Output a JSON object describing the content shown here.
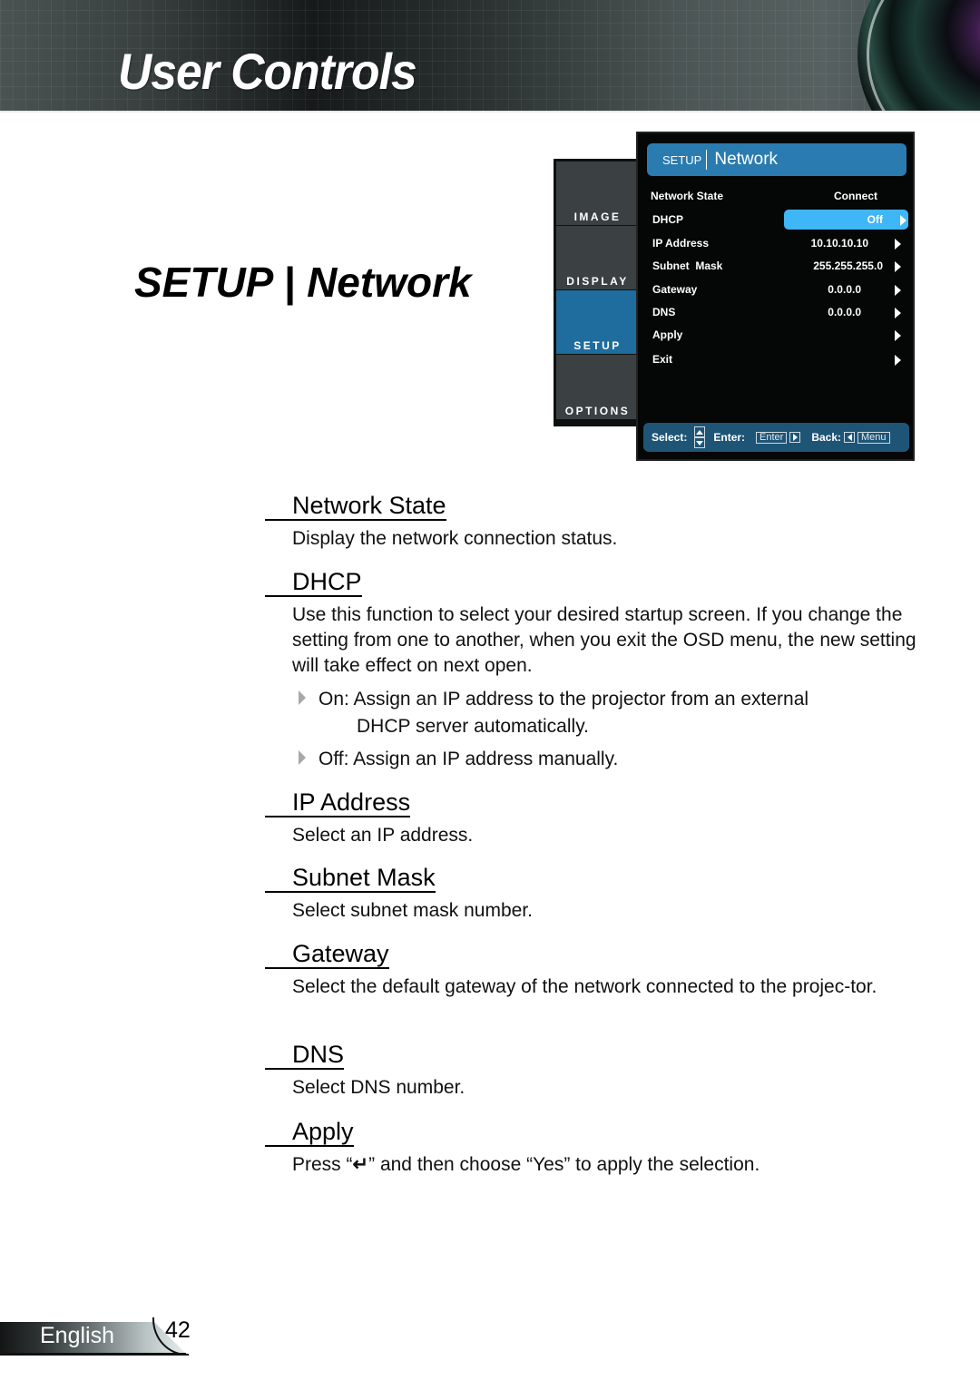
{
  "header": {
    "title": "User Controls"
  },
  "section_title": "SETUP | Network",
  "osd": {
    "tabs": [
      {
        "label": "IMAGE",
        "active": false
      },
      {
        "label": "DISPLAY",
        "active": false
      },
      {
        "label": "SETUP",
        "active": true
      },
      {
        "label": "OPTIONS",
        "active": false
      }
    ],
    "header": {
      "category": "SETUP",
      "page": "Network"
    },
    "rows": [
      {
        "label": "Network State",
        "value": "Connect",
        "arrow": false
      },
      {
        "label": "DHCP",
        "value": "Off",
        "arrow": true,
        "selected": true
      },
      {
        "label": "IP Address",
        "value": "10.10.10.10",
        "arrow": true
      },
      {
        "label": "Subnet  Mask",
        "value": "255.255.255.0",
        "arrow": true
      },
      {
        "label": "Gateway",
        "value": "0.0.0.0",
        "arrow": true
      },
      {
        "label": "DNS",
        "value": "0.0.0.0",
        "arrow": true
      },
      {
        "label": "Apply",
        "value": "",
        "arrow": true
      },
      {
        "label": "Exit",
        "value": "",
        "arrow": true
      }
    ],
    "footer": {
      "select_label": "Select:",
      "enter_label": "Enter:",
      "enter_key": "Enter",
      "back_label": "Back:",
      "menu_key": "Menu"
    },
    "colors": {
      "header_bg": "#2a7bb0",
      "highlight": "#3fb6f5",
      "active_tab": "#1f6c9f",
      "footer_bg": "#1e5577"
    }
  },
  "items": [
    {
      "title": "Network State",
      "desc": "Display the network connection status."
    },
    {
      "title": "DHCP",
      "desc": "Use this function to select your desired startup screen. If you change the setting from one to another, when you exit the OSD menu, the new setting will take effect on next open.",
      "bullets": [
        {
          "line1": "On: Assign an IP address to the projector from an external",
          "line2": "DHCP server automatically."
        },
        {
          "line1": "Off: Assign an IP address manually.",
          "line2": ""
        }
      ]
    },
    {
      "title": "IP Address",
      "desc": "Select an IP address."
    },
    {
      "title": "Subnet Mask",
      "desc": "Select subnet mask number."
    },
    {
      "title": "Gateway",
      "desc": "Select the default gateway of the network connected to the projec-tor."
    },
    {
      "title": "DNS",
      "desc": "Select DNS number."
    },
    {
      "title": "Apply",
      "desc_before": "Press “",
      "desc_icon": "↵",
      "desc_after": "” and then choose “Yes” to apply the selection."
    }
  ],
  "footer": {
    "language": "English",
    "page_number": "42"
  }
}
